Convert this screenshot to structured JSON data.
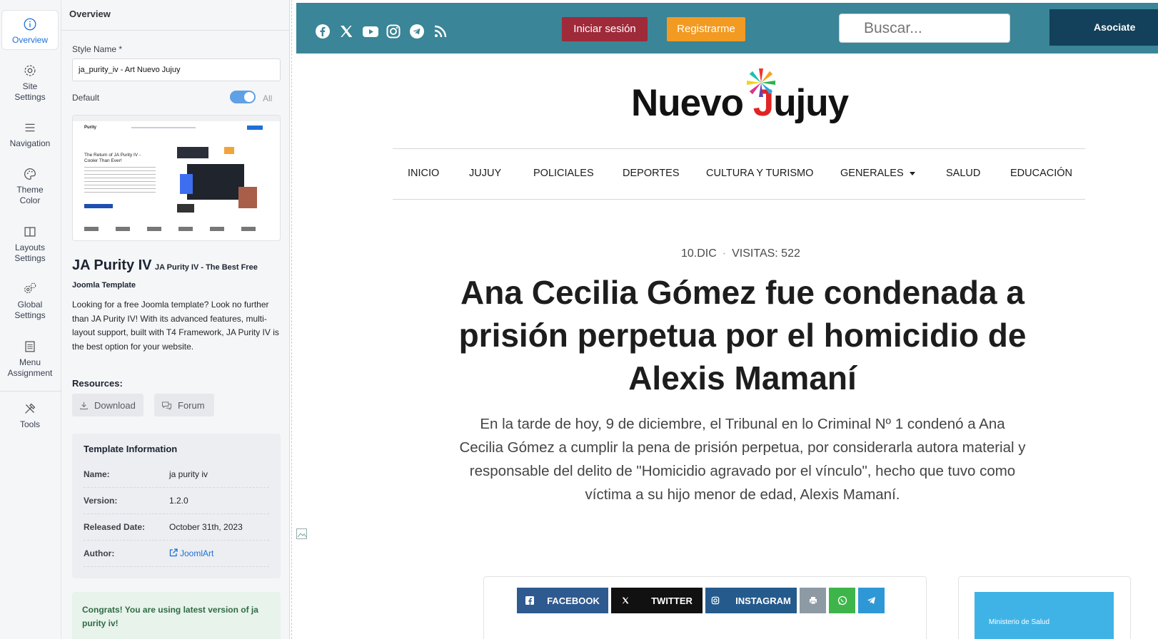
{
  "rail": {
    "items": [
      {
        "label": "Overview",
        "icon": "info-icon"
      },
      {
        "label": "Site Settings",
        "icon": "gear-icon"
      },
      {
        "label": "Navigation",
        "icon": "menu-icon"
      },
      {
        "label": "Theme Color",
        "icon": "palette-icon"
      },
      {
        "label": "Layouts Settings",
        "icon": "layout-icon"
      },
      {
        "label": "Global Settings",
        "icon": "gears-icon"
      },
      {
        "label": "Menu Assignment",
        "icon": "list-icon"
      },
      {
        "label": "Tools",
        "icon": "tools-icon"
      }
    ],
    "active_color": "#1e6fd9"
  },
  "panel": {
    "title": "Overview",
    "style_name_label": "Style Name *",
    "style_name_value": "ja_purity_iv - Art Nuevo Jujuy",
    "default_label": "Default",
    "default_toggle_text": "All",
    "template_name": "JA Purity IV",
    "template_tagline": "JA Purity IV - The Best Free Joomla Template",
    "description": "Looking for a free Joomla template? Look no further than JA Purity IV! With its advanced features, multi-layout support, built with T4 Framework, JA Purity IV is the best option for your website.",
    "resources_label": "Resources:",
    "download_label": "Download",
    "forum_label": "Forum",
    "info": {
      "title": "Template Information",
      "rows": [
        {
          "key": "Name:",
          "value": "ja purity iv"
        },
        {
          "key": "Version:",
          "value": "1.2.0"
        },
        {
          "key": "Released Date:",
          "value": "October 31th, 2023"
        },
        {
          "key": "Author:",
          "value": "JoomlArt"
        }
      ]
    },
    "congrats": "Congrats! You are using latest version of ja purity iv!"
  },
  "thumbnail": {
    "brand": "Purity",
    "hero_title": "The Return of JA Purity IV - Cooler Than Ever!"
  },
  "site": {
    "topbar_color": "#3a8597",
    "login_label": "Iniciar sesión",
    "register_label": "Registrarme",
    "search_placeholder": "Buscar...",
    "asociate_label": "Asociate",
    "logo_part1": "Nuevo ",
    "logo_j": "J",
    "logo_part2": "ujuy",
    "nav": [
      "INICIO",
      "JUJUY",
      "POLICIALES",
      "DEPORTES",
      "CULTURA Y TURISMO",
      "GENERALES",
      "SALUD",
      "EDUCACIÓN"
    ],
    "date": "10.DIC",
    "visits": "VISITAS: 522",
    "headline": "Ana Cecilia Gómez fue condenada a prisión perpetua por el homicidio de Alexis Mamaní",
    "lead": "En la tarde de hoy, 9 de diciembre, el Tribunal en lo Criminal Nº 1 condenó a Ana Cecilia Gómez a cumplir la pena de prisión perpetua, por considerarla autora material y responsable del delito de \"Homicidio agravado por el vínculo\", hecho que tuvo como víctima a su hijo menor de edad, Alexis Mamaní.",
    "share": {
      "facebook": "FACEBOOK",
      "twitter": "TWITTER",
      "instagram": "INSTAGRAM"
    },
    "ad_text": "Ministerio de Salud"
  }
}
